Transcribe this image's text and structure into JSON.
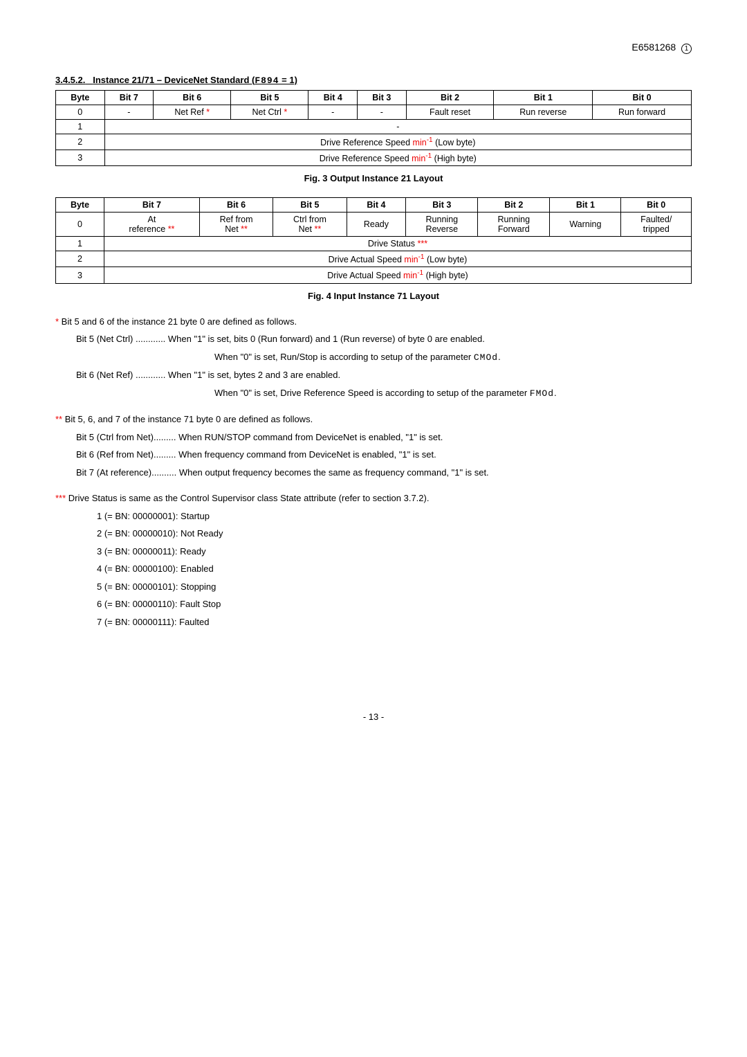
{
  "header": {
    "doc_code": "E6581268",
    "circled_num": "1"
  },
  "section1": {
    "heading_number": "3.4.5.2.",
    "heading_text": "Instance 21/71 – DeviceNet Standard (",
    "heading_param": "F894",
    "heading_tail": " = 1)"
  },
  "table1": {
    "headers": [
      "Byte",
      "Bit 7",
      "Bit 6",
      "Bit 5",
      "Bit 4",
      "Bit 3",
      "Bit 2",
      "Bit 1",
      "Bit 0"
    ],
    "row0": [
      "0",
      "-",
      "Net Ref ",
      "*",
      "Net Ctrl ",
      "*",
      "-",
      "-",
      "Fault reset",
      "Run reverse",
      "Run forward"
    ],
    "row1": [
      "1",
      "-"
    ],
    "row2_before": "Drive Reference Speed ",
    "row2_minpart": "min",
    "row2_sup": "-1",
    "row2_after": " (Low byte)",
    "row2_byte": "2",
    "row3_before": "Drive Reference Speed ",
    "row3_minpart": "min",
    "row3_sup": "-1",
    "row3_after": " (High byte)",
    "row3_byte": "3"
  },
  "fig3_caption": "Fig. 3 Output Instance 21 Layout",
  "table2": {
    "headers": [
      "Byte",
      "Bit 7",
      "Bit 6",
      "Bit 5",
      "Bit 4",
      "Bit 3",
      "Bit 2",
      "Bit 1",
      "Bit 0"
    ],
    "row0": {
      "byte": "0",
      "b7a": "At",
      "b7b": "reference ",
      "b7s": "**",
      "b6a": "Ref from",
      "b6b": "Net ",
      "b6s": "**",
      "b5a": "Ctrl from",
      "b5b": "Net ",
      "b5s": "**",
      "b4": "Ready",
      "b3a": "Running",
      "b3b": "Reverse",
      "b2a": "Running",
      "b2b": "Forward",
      "b1": "Warning",
      "b0a": "Faulted/",
      "b0b": "tripped"
    },
    "row1_byte": "1",
    "row1_text": "Drive Status ",
    "row1_stars": "***",
    "row2_byte": "2",
    "row2_before": "Drive Actual Speed ",
    "row2_min": "min",
    "row2_sup": "-1",
    "row2_after": " (Low byte)",
    "row3_byte": "3",
    "row3_before": "Drive Actual Speed ",
    "row3_min": "min",
    "row3_sup": "-1",
    "row3_after": " (High byte)"
  },
  "fig4_caption": "Fig. 4 Input Instance 71 Layout",
  "footnote1": {
    "star": "* ",
    "lead": "Bit 5 and 6 of the instance 21 byte 0 are defined as follows.",
    "l1a": "Bit 5 (Net Ctrl) ............ When \"1\" is set, bits 0 (Run forward) and 1 (Run reverse) of byte 0 are enabled.",
    "l1b_a": "When \"0\" is set, Run/Stop is according to setup of the parameter ",
    "l1b_b": "CMOd",
    "l1b_c": ".",
    "l2a": "Bit 6 (Net Ref) ............ When \"1\" is set, bytes 2 and 3 are enabled.",
    "l2b_a": "When \"0\" is set, Drive Reference Speed is according to setup of the parameter ",
    "l2b_b": "FMOd",
    "l2b_c": "."
  },
  "footnote2": {
    "star": "** ",
    "lead": "Bit 5, 6, and 7 of the instance 71 byte 0 are defined as follows.",
    "l1": "Bit 5 (Ctrl from Net)......... When RUN/STOP command from DeviceNet is enabled, \"1\" is set.",
    "l2": "Bit 6 (Ref from Net)......... When frequency command from DeviceNet is enabled, \"1\" is set.",
    "l3": "Bit 7 (At reference).......... When output frequency becomes the same as frequency command, \"1\" is set."
  },
  "footnote3": {
    "star": "*** ",
    "lead": "Drive Status is same as the Control Supervisor class State attribute (refer to section 3.7.2).",
    "items": [
      "1 (= BN: 00000001): Startup",
      "2 (= BN: 00000010): Not Ready",
      "3 (= BN: 00000011): Ready",
      "4 (= BN: 00000100): Enabled",
      "5 (= BN: 00000101): Stopping",
      "6 (= BN: 00000110): Fault Stop",
      "7 (= BN: 00000111): Faulted"
    ]
  },
  "page_num": "- 13 -"
}
